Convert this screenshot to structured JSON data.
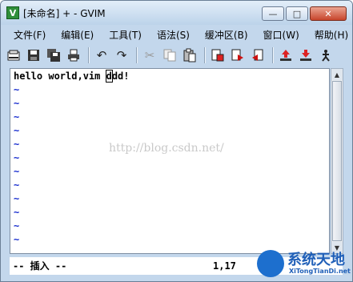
{
  "window": {
    "title": "[未命名] + - GVIM",
    "controls": {
      "minimize": "—",
      "maximize": "□",
      "close": "✕"
    }
  },
  "menubar": {
    "items": [
      "文件(F)",
      "编辑(E)",
      "工具(T)",
      "语法(S)",
      "缓冲区(B)",
      "窗口(W)",
      "帮助(H)"
    ]
  },
  "toolbar": {
    "icons": [
      "open-icon",
      "save-icon",
      "save-all-icon",
      "print-icon",
      "undo-icon",
      "redo-icon",
      "cut-icon",
      "copy-icon",
      "paste-icon",
      "find-replace-icon",
      "find-next-icon",
      "find-prev-icon",
      "load-session-icon",
      "save-session-icon",
      "run-script-icon"
    ]
  },
  "editor": {
    "line1_before_cursor": "hello world,vim ",
    "line1_cursor_char": "d",
    "line1_after_cursor": "dd!",
    "tilde": "~"
  },
  "statusbar": {
    "mode": "-- 插入 --",
    "position": "1,17"
  },
  "watermark": {
    "text": "http://blog.csdn.net/"
  },
  "logo": {
    "title": "系统天地",
    "subtitle": "XiTongTianDi.net"
  }
}
